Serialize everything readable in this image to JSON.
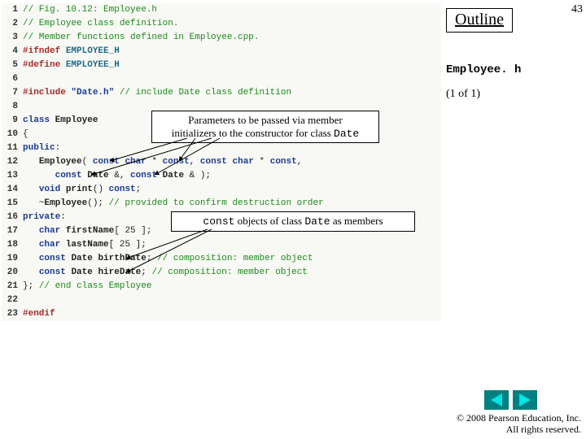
{
  "page_number": "43",
  "outline_label": "Outline",
  "filename": "Employee. h",
  "page_of": "(1 of 1)",
  "callout1_html": "Parameters to be passed via member<br>initializers to the constructor for class <span class=\"mono\">Date</span>",
  "callout2_html": "<span class=\"mono\">const</span> objects of class <span class=\"mono\">Date</span> as members",
  "copyright": "© 2008 Pearson Education, Inc.  All rights reserved.",
  "code": [
    {
      "n": "1",
      "seg": [
        {
          "c": "tok-comment",
          "t": "// Fig. 10.12: Employee.h"
        }
      ]
    },
    {
      "n": "2",
      "seg": [
        {
          "c": "tok-comment",
          "t": "// Employee class definition."
        }
      ]
    },
    {
      "n": "3",
      "seg": [
        {
          "c": "tok-comment",
          "t": "// Member functions defined in Employee.cpp."
        }
      ]
    },
    {
      "n": "4",
      "seg": [
        {
          "c": "tok-pp",
          "t": "#ifndef "
        },
        {
          "c": "tok-macro",
          "t": "EMPLOYEE_H"
        }
      ]
    },
    {
      "n": "5",
      "seg": [
        {
          "c": "tok-pp",
          "t": "#define "
        },
        {
          "c": "tok-macro",
          "t": "EMPLOYEE_H"
        }
      ]
    },
    {
      "n": "6",
      "seg": []
    },
    {
      "n": "7",
      "seg": [
        {
          "c": "tok-pp",
          "t": "#include "
        },
        {
          "c": "tok-str",
          "t": "\"Date.h\""
        },
        {
          "c": "tok-plain",
          "t": " "
        },
        {
          "c": "tok-comment",
          "t": "// include Date class definition"
        }
      ]
    },
    {
      "n": "8",
      "seg": []
    },
    {
      "n": "9",
      "seg": [
        {
          "c": "tok-kw",
          "t": "class"
        },
        {
          "c": "tok-plain",
          "t": " "
        },
        {
          "c": "tok-ident",
          "t": "Employee"
        }
      ]
    },
    {
      "n": "10",
      "seg": [
        {
          "c": "tok-plain",
          "t": "{"
        }
      ]
    },
    {
      "n": "11",
      "seg": [
        {
          "c": "tok-kw",
          "t": "public"
        },
        {
          "c": "tok-plain",
          "t": ":"
        }
      ]
    },
    {
      "n": "12",
      "seg": [
        {
          "c": "tok-plain",
          "t": "   "
        },
        {
          "c": "tok-ident",
          "t": "Employee"
        },
        {
          "c": "tok-plain",
          "t": "( "
        },
        {
          "c": "tok-kw",
          "t": "const"
        },
        {
          "c": "tok-plain",
          "t": " "
        },
        {
          "c": "tok-kw",
          "t": "char"
        },
        {
          "c": "tok-plain",
          "t": " * "
        },
        {
          "c": "tok-kw",
          "t": "const"
        },
        {
          "c": "tok-plain",
          "t": ", "
        },
        {
          "c": "tok-kw",
          "t": "const"
        },
        {
          "c": "tok-plain",
          "t": " "
        },
        {
          "c": "tok-kw",
          "t": "char"
        },
        {
          "c": "tok-plain",
          "t": " * "
        },
        {
          "c": "tok-kw",
          "t": "const"
        },
        {
          "c": "tok-plain",
          "t": ","
        }
      ]
    },
    {
      "n": "13",
      "seg": [
        {
          "c": "tok-plain",
          "t": "      "
        },
        {
          "c": "tok-kw",
          "t": "const"
        },
        {
          "c": "tok-plain",
          "t": " "
        },
        {
          "c": "tok-ident",
          "t": "Date"
        },
        {
          "c": "tok-plain",
          "t": " &, "
        },
        {
          "c": "tok-kw",
          "t": "const"
        },
        {
          "c": "tok-plain",
          "t": " "
        },
        {
          "c": "tok-ident",
          "t": "Date"
        },
        {
          "c": "tok-plain",
          "t": " & );"
        }
      ]
    },
    {
      "n": "14",
      "seg": [
        {
          "c": "tok-plain",
          "t": "   "
        },
        {
          "c": "tok-kw",
          "t": "void"
        },
        {
          "c": "tok-plain",
          "t": " "
        },
        {
          "c": "tok-ident",
          "t": "print"
        },
        {
          "c": "tok-plain",
          "t": "() "
        },
        {
          "c": "tok-kw",
          "t": "const"
        },
        {
          "c": "tok-plain",
          "t": ";"
        }
      ]
    },
    {
      "n": "15",
      "seg": [
        {
          "c": "tok-plain",
          "t": "   ~"
        },
        {
          "c": "tok-ident",
          "t": "Employee"
        },
        {
          "c": "tok-plain",
          "t": "(); "
        },
        {
          "c": "tok-comment",
          "t": "// provided to confirm destruction order"
        }
      ]
    },
    {
      "n": "16",
      "seg": [
        {
          "c": "tok-kw",
          "t": "private"
        },
        {
          "c": "tok-plain",
          "t": ":"
        }
      ]
    },
    {
      "n": "17",
      "seg": [
        {
          "c": "tok-plain",
          "t": "   "
        },
        {
          "c": "tok-kw",
          "t": "char"
        },
        {
          "c": "tok-plain",
          "t": " "
        },
        {
          "c": "tok-ident",
          "t": "firstName"
        },
        {
          "c": "tok-plain",
          "t": "[ 25 ];"
        }
      ]
    },
    {
      "n": "18",
      "seg": [
        {
          "c": "tok-plain",
          "t": "   "
        },
        {
          "c": "tok-kw",
          "t": "char"
        },
        {
          "c": "tok-plain",
          "t": " "
        },
        {
          "c": "tok-ident",
          "t": "lastName"
        },
        {
          "c": "tok-plain",
          "t": "[ 25 ];"
        }
      ]
    },
    {
      "n": "19",
      "seg": [
        {
          "c": "tok-plain",
          "t": "   "
        },
        {
          "c": "tok-kw",
          "t": "const"
        },
        {
          "c": "tok-plain",
          "t": " "
        },
        {
          "c": "tok-ident",
          "t": "Date"
        },
        {
          "c": "tok-plain",
          "t": " "
        },
        {
          "c": "tok-ident",
          "t": "birthDate"
        },
        {
          "c": "tok-plain",
          "t": "; "
        },
        {
          "c": "tok-comment",
          "t": "// composition: member object"
        }
      ]
    },
    {
      "n": "20",
      "seg": [
        {
          "c": "tok-plain",
          "t": "   "
        },
        {
          "c": "tok-kw",
          "t": "const"
        },
        {
          "c": "tok-plain",
          "t": " "
        },
        {
          "c": "tok-ident",
          "t": "Date"
        },
        {
          "c": "tok-plain",
          "t": " "
        },
        {
          "c": "tok-ident",
          "t": "hireDate"
        },
        {
          "c": "tok-plain",
          "t": "; "
        },
        {
          "c": "tok-comment",
          "t": "// composition: member object"
        }
      ]
    },
    {
      "n": "21",
      "seg": [
        {
          "c": "tok-plain",
          "t": "}; "
        },
        {
          "c": "tok-comment",
          "t": "// end class Employee"
        }
      ]
    },
    {
      "n": "22",
      "seg": []
    },
    {
      "n": "23",
      "seg": [
        {
          "c": "tok-pp",
          "t": "#endif"
        }
      ]
    }
  ]
}
